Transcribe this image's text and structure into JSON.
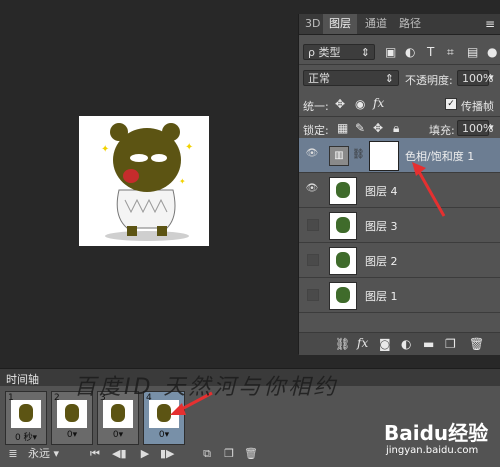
{
  "canvas": {
    "character": "bear-sticker"
  },
  "layers_panel": {
    "tabs": [
      "3D",
      "图层",
      "通道",
      "路径"
    ],
    "active_tab": "图层",
    "kind_filter": "ρ 类型",
    "blend_mode": "正常",
    "opacity_label": "不透明度:",
    "opacity_value": "100%",
    "unify_label": "统一:",
    "propagate_label": "传播帧",
    "lock_label": "锁定:",
    "fill_label": "填充:",
    "fill_value": "100%",
    "layers": [
      {
        "name": "色相/饱和度 1",
        "visible": true,
        "type": "adjustment"
      },
      {
        "name": "图层 4",
        "visible": true,
        "type": "pixel"
      },
      {
        "name": "图层 3",
        "visible": false,
        "type": "pixel"
      },
      {
        "name": "图层 2",
        "visible": false,
        "type": "pixel"
      },
      {
        "name": "图层 1",
        "visible": false,
        "type": "pixel"
      }
    ]
  },
  "timeline": {
    "title": "时间轴",
    "frames": [
      {
        "number": "1",
        "delay": "0 秒▾"
      },
      {
        "number": "2",
        "delay": "0▾"
      },
      {
        "number": "3",
        "delay": "0▾"
      },
      {
        "number": "4",
        "delay": "0▾"
      }
    ],
    "loop": "永远",
    "watermark": "百度ID 天然河与你相约",
    "logo_text": "Baidu经验",
    "logo_url": "jingyan.baidu.com"
  },
  "colors": {
    "panel_bg": "#535353",
    "selected": "#6c7d92",
    "arrow": "#e53030"
  }
}
